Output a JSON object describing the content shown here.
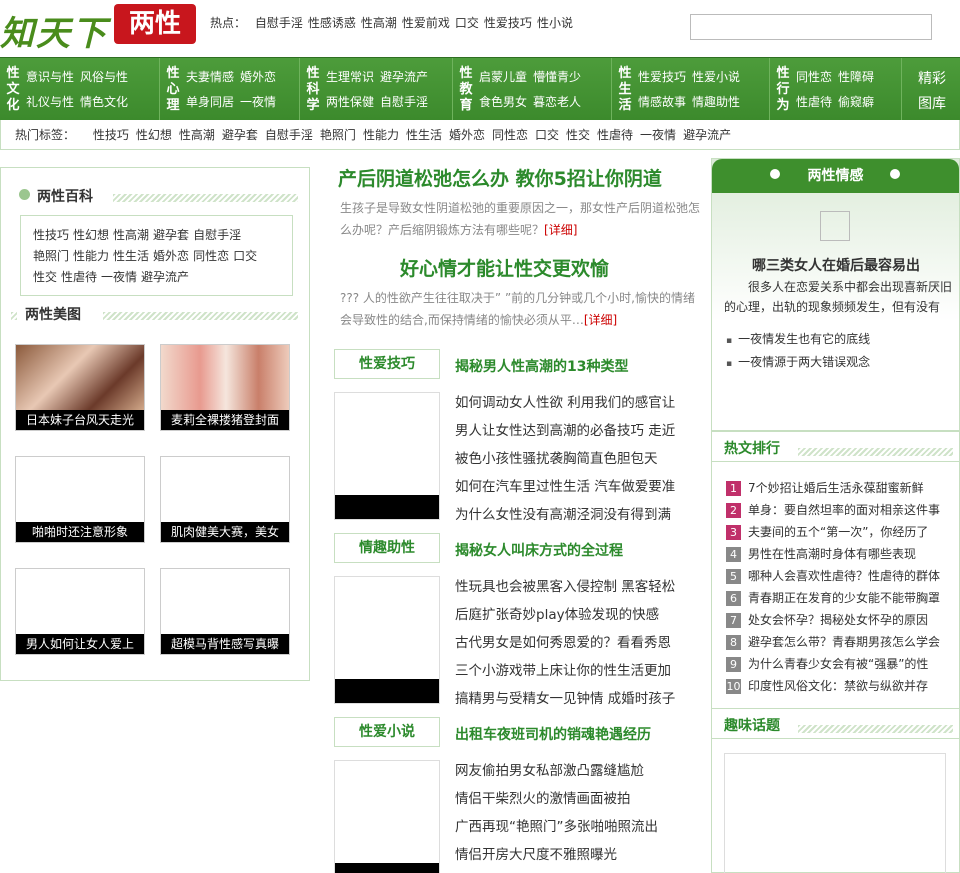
{
  "logo": {
    "text": "知天下",
    "badge": "两性"
  },
  "hot": {
    "label": "热点：",
    "items": [
      "自慰手淫",
      "性感诱惑",
      "性高潮",
      "性爱前戏",
      "口交",
      "性爱技巧",
      "性小说"
    ]
  },
  "search": {
    "placeholder": ""
  },
  "nav": [
    {
      "cat": "性文化",
      "row1": [
        "意识与性",
        "风俗与性"
      ],
      "row2": [
        "礼仪与性",
        "情色文化"
      ]
    },
    {
      "cat": "性心理",
      "row1": [
        "夫妻情感",
        "婚外恋"
      ],
      "row2": [
        "单身同居",
        "一夜情"
      ]
    },
    {
      "cat": "性科学",
      "row1": [
        "生理常识",
        "避孕流产"
      ],
      "row2": [
        "两性保健",
        "自慰手淫"
      ]
    },
    {
      "cat": "性教育",
      "row1": [
        "启蒙儿童",
        "懵懂青少"
      ],
      "row2": [
        "食色男女",
        "暮恋老人"
      ]
    },
    {
      "cat": "性生活",
      "row1": [
        "性爱技巧",
        "性爱小说"
      ],
      "row2": [
        "情感故事",
        "情趣助性"
      ]
    },
    {
      "cat": "性行为",
      "row1": [
        "同性恋",
        "性障碍"
      ],
      "row2": [
        "性虐待",
        "偷窥癖"
      ]
    },
    {
      "cat": "",
      "row1": [
        "精彩"
      ],
      "row2": [
        "图库"
      ]
    }
  ],
  "tags": {
    "label": "热门标签：",
    "items": [
      "性技巧",
      "性幻想",
      "性高潮",
      "避孕套",
      "自慰手淫",
      "艳照门",
      "性能力",
      "性生活",
      "婚外恋",
      "同性恋",
      "口交",
      "性交",
      "性虐待",
      "一夜情",
      "避孕流产"
    ]
  },
  "left": {
    "encyclopedia_title": "两性百科",
    "encyclopedia_tags": [
      "性技巧",
      "性幻想",
      "性高潮",
      "避孕套",
      "自慰手淫",
      "艳照门",
      "性能力",
      "性生活",
      "婚外恋",
      "同性恋",
      "口交",
      "性交",
      "性虐待",
      "一夜情",
      "避孕流产"
    ],
    "gallery_title": "两性美图",
    "gallery": [
      "日本妹子台风天走光",
      "麦莉全裸搂猪登封面",
      "啪啪时还注意形象",
      "肌肉健美大赛，美女",
      "男人如何让女人爱上",
      "超模马背性感写真曝"
    ]
  },
  "main": {
    "headline1": "产后阴道松弛怎么办  教你5招让你阴道",
    "desc1": "生孩子是导致女性阴道松弛的重要原因之一，那女性产后阴道松弛怎么办呢？产后缩阴锻炼方法有哪些呢？",
    "more": "[详细]",
    "headline2": "好心情才能让性交更欢愉",
    "desc2": "??? 人的性欲产生往往取决于” ”前的几分钟或几个小时,愉快的情绪会导致性的结合,而保持情绪的愉快必须从平…",
    "sections": [
      {
        "label": "性爱技巧",
        "title": "揭秘男人性高潮的13种类型",
        "items": [
          "如何调动女人性欲  利用我们的感官让",
          "男人让女性达到高潮的必备技巧  走近",
          "被色小孩性骚扰袭胸简直色胆包天",
          "如何在汽车里过性生活  汽车做爱要准",
          "为什么女性没有高潮泾洞没有得到满"
        ]
      },
      {
        "label": "情趣助性",
        "title": "揭秘女人叫床方式的全过程",
        "items": [
          "性玩具也会被黑客入侵控制  黑客轻松",
          "后庭扩张奇妙play体验发现的快感",
          "古代男女是如何秀恩爱的？看看秀恩",
          "三个小游戏带上床让你的性生活更加",
          "搞精男与受精女一见钟情  成婚时孩子"
        ]
      },
      {
        "label": "性爱小说",
        "title": "出租车夜班司机的销魂艳遇经历",
        "items": [
          "网友偷拍男女私部激凸露缝尴尬",
          "情侣干柴烈火的激情画面被拍",
          "广西再现“艳照门”多张啪啪照流出",
          "情侣开房大尺度不雅照曝光"
        ]
      }
    ]
  },
  "right": {
    "emotion_title": "两性情感",
    "emotion_headline": "哪三类女人在婚后最容易出",
    "emotion_desc": "很多人在恋爱关系中都会出现喜新厌旧的心理，出轨的现象频频发生，但有没有",
    "emotion_links": [
      "一夜情发生也有它的底线",
      "一夜情源于两大错误观念"
    ],
    "rank_title": "热文排行",
    "rank": [
      "7个妙招让婚后生活永葆甜蜜新鲜",
      "单身：要自然坦率的面对相亲这件事",
      "夫妻间的五个“第一次”，你经历了",
      "男性在性高潮时身体有哪些表现",
      "哪种人会喜欢性虐待？性虐待的群体",
      "青春期正在发育的少女能不能带胸罩",
      "处女会怀孕？揭秘处女怀孕的原因",
      "避孕套怎么带？青春期男孩怎么学会",
      "为什么青春少女会有被“强暴”的性",
      "印度性风俗文化：禁欲与纵欲并存"
    ],
    "rank_colors": [
      "#c0306a",
      "#c0306a",
      "#c0306a",
      "#888888"
    ],
    "topic_title": "趣味话题"
  }
}
